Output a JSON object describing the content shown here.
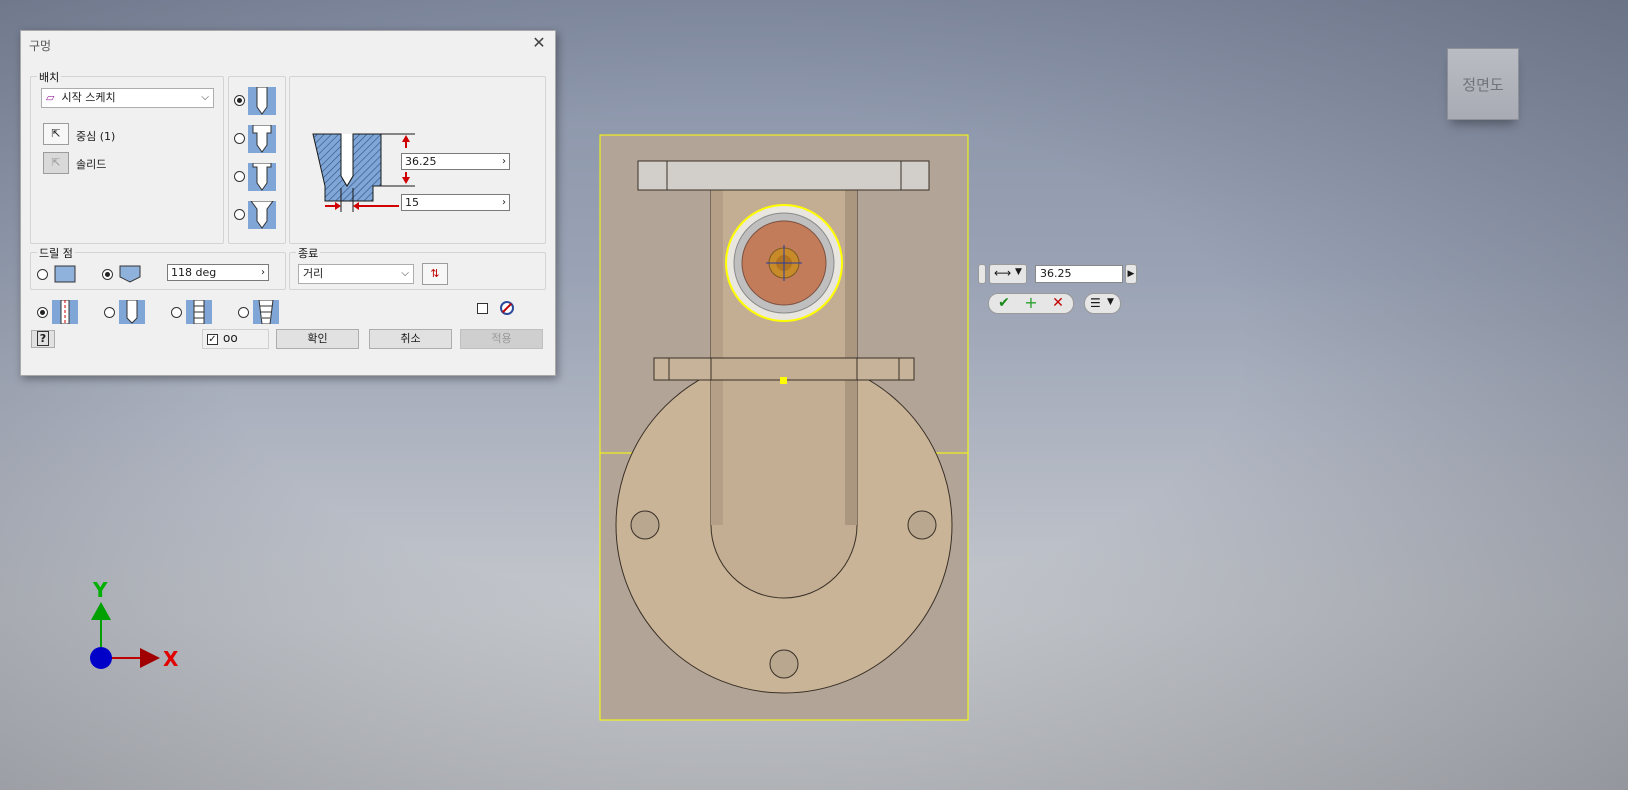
{
  "dialog": {
    "title": "구멍",
    "close_glyph": "✕",
    "placement": {
      "label": "배치",
      "combo_value": "시작 스케치",
      "center_label": "중심 (1)",
      "solid_label": "솔리드"
    },
    "dimensions": {
      "depth_value": "36.25",
      "diameter_value": "15"
    },
    "drill_point": {
      "label": "드릴 점",
      "angle_value": "118 deg"
    },
    "termination": {
      "label": "종료",
      "combo_value": "거리"
    },
    "buttons": {
      "ok": "확인",
      "cancel": "취소",
      "apply": "적용",
      "help": "?"
    },
    "hole_types_selected": 0,
    "drill_point_selected": 1,
    "thread_type_selected": 0
  },
  "viewcube": {
    "face_label": "정면도"
  },
  "mini_toolbar": {
    "value": "36.25"
  },
  "axes": {
    "x_label": "X",
    "y_label": "Y"
  },
  "colors": {
    "selection": "#ffff00",
    "part": "#c9b49a",
    "hole_face": "#c27c5a",
    "axis_x": "#c00000",
    "axis_y": "#00a000",
    "axis_origin": "#0000c8"
  },
  "icons": [
    "close-icon",
    "sketch-icon",
    "cursor-icon",
    "chevron-down-icon",
    "flip-icon",
    "help-icon",
    "preview-glasses-icon",
    "check-icon",
    "plus-icon",
    "cancel-x-icon",
    "list-icon",
    "dimension-icon"
  ]
}
